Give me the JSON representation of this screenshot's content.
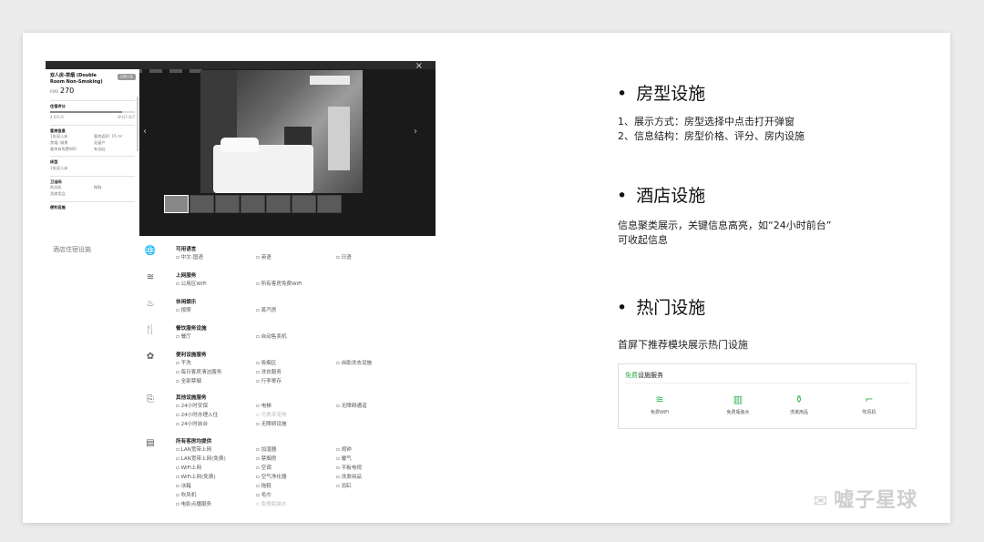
{
  "modal": {
    "room_title": "双人房-禁烟 (Double Room Non-Smoking)",
    "tag": "立即入住",
    "price_currency": "RMB",
    "price": "270",
    "rating_label": "住宿评分",
    "rating_value": "4.6/5.0",
    "score_note": "评分7.6/7",
    "facility_label": "客房信息",
    "facilities": [
      "1张双人床",
      "客房面积: 15 m²",
      "禁烟, 城景",
      "无窗户",
      "客房有免费WiFi",
      "有浴缸"
    ],
    "bed_label": "床型",
    "bed_value": "1张双人床",
    "bath_label": "卫浴间",
    "bath_items": [
      "吹风机",
      "拖鞋",
      "洗漱用品"
    ],
    "more_label": "便利设施"
  },
  "facility_section_label": "酒店住宿设施",
  "facility_groups": [
    {
      "icon": "globe-icon",
      "glyph": "🌐",
      "title": "可用语言",
      "items": [
        "中文-国语",
        "英语",
        "日语"
      ]
    },
    {
      "icon": "wifi-icon",
      "glyph": "≋",
      "title": "上网服务",
      "items": [
        "公用区WiFi",
        "所有客房免费WiFi"
      ]
    },
    {
      "icon": "leisure-icon",
      "glyph": "♨",
      "title": "休闲娱乐",
      "items": [
        "按摩",
        "蒸汽房"
      ]
    },
    {
      "icon": "dining-icon",
      "glyph": "🍴",
      "title": "餐饮服务设施",
      "items": [
        "餐厅",
        "自动售卖机"
      ]
    },
    {
      "icon": "service-icon",
      "glyph": "✿",
      "title": "便利设施服务",
      "items": [
        "干洗",
        "吸烟区",
        "自助洗衣设施",
        "每日客房清洁服务",
        "洗衣服务",
        "",
        "全部禁烟",
        "行李寄存",
        ""
      ]
    },
    {
      "icon": "other-icon",
      "glyph": "⎘",
      "title": "其他设施服务",
      "items": [
        "24小时安保",
        "电梯",
        "无障碍通道",
        "24小时办理入住",
        "可携带宠物",
        "",
        "24小时前台",
        "无障碍设施",
        ""
      ]
    },
    {
      "icon": "room-icon",
      "glyph": "▤",
      "title": "所有客房均提供",
      "items": [
        "LAN宽带上网",
        "加湿器",
        "闹钟",
        "LAN宽带上网(免费)",
        "禁烟房",
        "暖气",
        "WiFi上网",
        "空调",
        "平板电视",
        "WiFi上网(免费)",
        "空气净化器",
        "洗漱用品",
        "冰箱",
        "拖鞋",
        "浴缸",
        "吹风机",
        "毛巾",
        "",
        "电影点播服务",
        "免费瓶装水",
        ""
      ]
    }
  ],
  "right": {
    "s1_title": "房型设施",
    "s1_line1": "1、展示方式：房型选择中点击打开弹窗",
    "s1_line2": "2、信息结构：房型价格、评分、房内设施",
    "s2_title": "酒店设施",
    "s2_line1": "信息聚类展示，关键信息高亮，如“24小时前台”",
    "s2_line2": "可收起信息",
    "s3_title": "热门设施",
    "s3_line1": "首屏下推荐模块展示热门设施",
    "card_title_green": "免费",
    "card_title_rest": "设施服务",
    "card_items": [
      {
        "icon": "wifi-icon",
        "glyph": "≋",
        "label": "免费WiFi"
      },
      {
        "icon": "water-bottle-icon",
        "glyph": "▥",
        "label": "免费瓶装水"
      },
      {
        "icon": "toiletries-icon",
        "glyph": "⚱",
        "label": "洗漱用品"
      },
      {
        "icon": "hair-dryer-icon",
        "glyph": "⌐",
        "label": "吹风机"
      }
    ]
  },
  "watermark": "嘘子星球"
}
